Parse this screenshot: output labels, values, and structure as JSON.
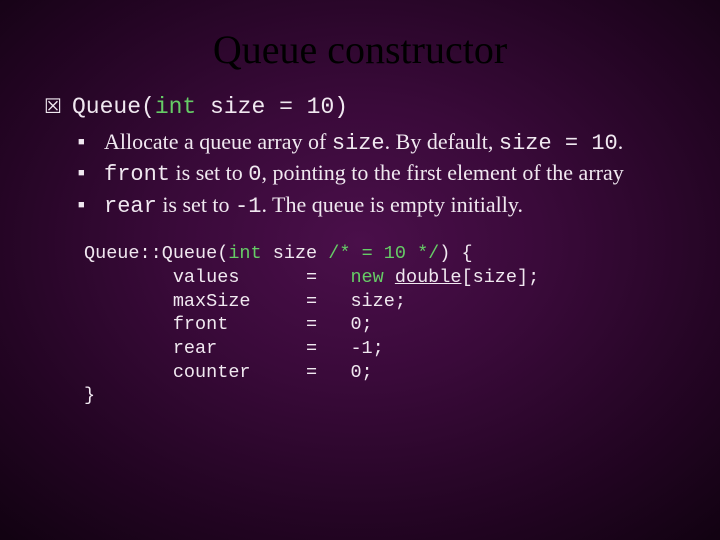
{
  "title": "Queue constructor",
  "signature": {
    "pre": "Queue(",
    "kw": "int",
    "post": " size = 10)"
  },
  "bullets": [
    {
      "parts": {
        "a": "Allocate a queue array of ",
        "b": "size",
        "c": ". By default, ",
        "d": "size = 10",
        "e": "."
      }
    },
    {
      "parts": {
        "a": "front",
        "b": " is set to ",
        "c": "0",
        "d": ", pointing to the first element of the array"
      }
    },
    {
      "parts": {
        "a": "rear",
        "b": " is set to ",
        "c": "-1",
        "d": ". The queue is empty initially."
      }
    }
  ],
  "code": {
    "l1a": "Queue::Queue(",
    "l1kw": "int",
    "l1b": " size ",
    "l1cm": "/* = 10 */",
    "l1c": ") {",
    "l2a": "        values      =   ",
    "l2kw": "new",
    "l2b": " ",
    "l2u": "double",
    "l2c": "[size];",
    "l3": "        maxSize     =   size;",
    "l4": "        front       =   0;",
    "l5": "        rear        =   -1;",
    "l6": "        counter     =   0;",
    "l7": "}"
  }
}
